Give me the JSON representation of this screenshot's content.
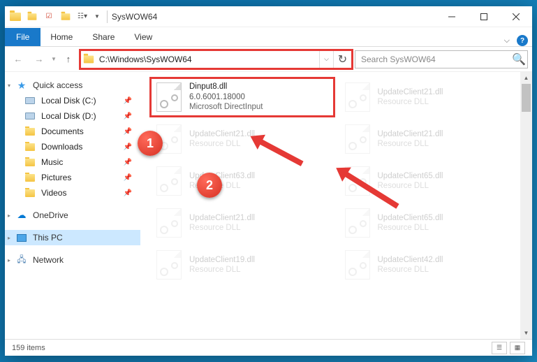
{
  "window": {
    "title": "SysWOW64"
  },
  "ribbon": {
    "file": "File",
    "home": "Home",
    "share": "Share",
    "view": "View"
  },
  "nav": {
    "path": "C:\\Windows\\SysWOW64",
    "search_placeholder": "Search SysWOW64"
  },
  "sidebar": {
    "quick_access": "Quick access",
    "items": [
      {
        "label": "Local Disk (C:)",
        "icon": "drive"
      },
      {
        "label": "Local Disk (D:)",
        "icon": "drive"
      },
      {
        "label": "Documents",
        "icon": "folder"
      },
      {
        "label": "Downloads",
        "icon": "folder"
      },
      {
        "label": "Music",
        "icon": "folder"
      },
      {
        "label": "Pictures",
        "icon": "folder"
      },
      {
        "label": "Videos",
        "icon": "folder"
      }
    ],
    "onedrive": "OneDrive",
    "this_pc": "This PC",
    "network": "Network"
  },
  "file_highlight": {
    "name": "Dinput8.dll",
    "version": "6.0.6001.18000",
    "desc": "Microsoft DirectInput"
  },
  "bg_files": [
    {
      "name": "UpdateClient21.dll",
      "desc": "Resource DLL"
    },
    {
      "name": "UpdateClient21.dll",
      "desc": "Resource DLL"
    },
    {
      "name": "UpdateClient21.dll",
      "desc": "Resource DLL"
    },
    {
      "name": "UpdateClient63.dll",
      "desc": "Resource DLL"
    },
    {
      "name": "UpdateClient65.dll",
      "desc": "Resource DLL"
    },
    {
      "name": "UpdateClient21.dll",
      "desc": "Resource DLL"
    },
    {
      "name": "UpdateClient65.dll",
      "desc": "Resource DLL"
    },
    {
      "name": "UpdateClient19.dll",
      "desc": "Resource DLL"
    },
    {
      "name": "UpdateClient42.dll",
      "desc": "Resource DLL"
    }
  ],
  "status": {
    "count": "159 items"
  },
  "markers": {
    "m1": "1",
    "m2": "2"
  }
}
